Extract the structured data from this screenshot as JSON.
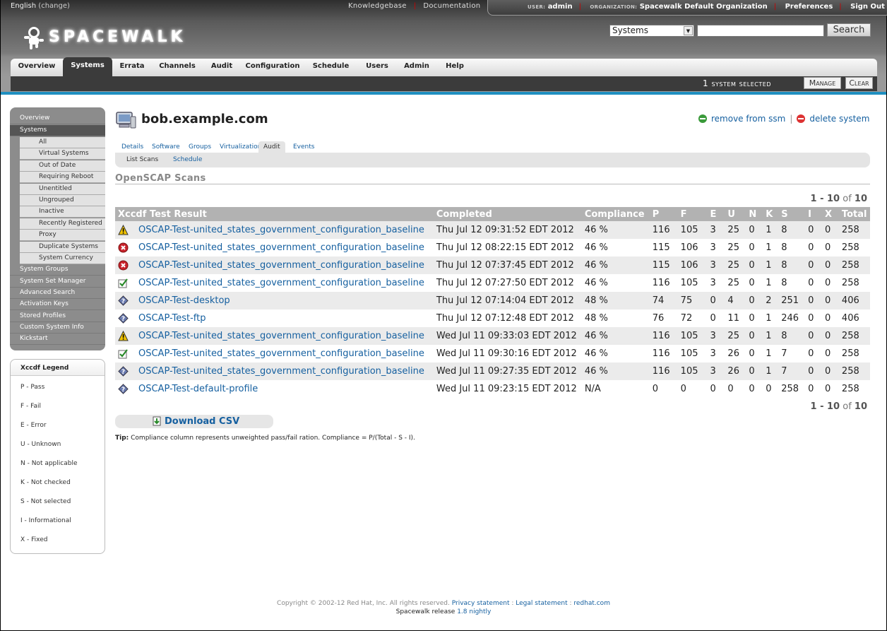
{
  "top": {
    "language": "English",
    "change": "(change)",
    "knowledgebase": "Knowledgebase",
    "documentation": "Documentation",
    "user_label": "USER:",
    "user": "admin",
    "org_label": "ORGANIZATION:",
    "org": "Spacewalk Default Organization",
    "preferences": "Preferences",
    "signout": "Sign Out"
  },
  "logo": "SPACEWALK",
  "search": {
    "scope": "Systems",
    "value": "",
    "button": "Search"
  },
  "nav": [
    "Overview",
    "Systems",
    "Errata",
    "Channels",
    "Audit",
    "Configuration",
    "Schedule",
    "Users",
    "Admin",
    "Help"
  ],
  "ssm": {
    "count": "1",
    "text": "system selected",
    "manage": "Manage",
    "clear": "Clear"
  },
  "sidebar": {
    "top": [
      "Overview",
      "Systems"
    ],
    "subs": [
      "All",
      "Virtual Systems",
      "Out of Date",
      "Requiring Reboot",
      "Unentitled",
      "Ungrouped",
      "Inactive",
      "Recently Registered",
      "Proxy",
      "Duplicate Systems",
      "System Currency"
    ],
    "bottom": [
      "System Groups",
      "System Set Manager",
      "Advanced Search",
      "Activation Keys",
      "Stored Profiles",
      "Custom System Info",
      "Kickstart"
    ]
  },
  "legend": {
    "title": "Xccdf Legend",
    "items": [
      "P - Pass",
      "F - Fail",
      "E - Error",
      "U - Unknown",
      "N - Not applicable",
      "K - Not checked",
      "S - Not selected",
      "I - Informational",
      "X - Fixed"
    ]
  },
  "system": {
    "name": "bob.example.com",
    "remove": "remove from ssm",
    "delete": "delete system"
  },
  "tabs": [
    "Details",
    "Software",
    "Groups",
    "Virtualization",
    "Audit",
    "Events"
  ],
  "subtabs": [
    "List Scans",
    "Schedule"
  ],
  "section_title": "OpenSCAP Scans",
  "pager": {
    "range": "1 - 10",
    "of": "of",
    "total": "10"
  },
  "table": {
    "headers": [
      "Xccdf Test Result",
      "Completed",
      "Compliance",
      "P",
      "F",
      "E",
      "U",
      "N",
      "K",
      "S",
      "I",
      "X",
      "Total"
    ],
    "rows": [
      {
        "icon": "warning",
        "name": "OSCAP-Test-united_states_government_configuration_baseline",
        "completed": "Thu Jul 12 09:31:52 EDT 2012",
        "compliance": "46 %",
        "p": "116",
        "f": "105",
        "e": "3",
        "u": "25",
        "n": "0",
        "k": "1",
        "s": "8",
        "i": "0",
        "x": "0",
        "total": "258"
      },
      {
        "icon": "error",
        "name": "OSCAP-Test-united_states_government_configuration_baseline",
        "completed": "Thu Jul 12 08:22:15 EDT 2012",
        "compliance": "46 %",
        "p": "115",
        "f": "106",
        "e": "3",
        "u": "25",
        "n": "0",
        "k": "1",
        "s": "8",
        "i": "0",
        "x": "0",
        "total": "258"
      },
      {
        "icon": "error",
        "name": "OSCAP-Test-united_states_government_configuration_baseline",
        "completed": "Thu Jul 12 07:37:45 EDT 2012",
        "compliance": "46 %",
        "p": "115",
        "f": "106",
        "e": "3",
        "u": "25",
        "n": "0",
        "k": "1",
        "s": "8",
        "i": "0",
        "x": "0",
        "total": "258"
      },
      {
        "icon": "ok",
        "name": "OSCAP-Test-united_states_government_configuration_baseline",
        "completed": "Thu Jul 12 07:27:50 EDT 2012",
        "compliance": "46 %",
        "p": "116",
        "f": "105",
        "e": "3",
        "u": "25",
        "n": "0",
        "k": "1",
        "s": "8",
        "i": "0",
        "x": "0",
        "total": "258"
      },
      {
        "icon": "unknown",
        "name": "OSCAP-Test-desktop",
        "completed": "Thu Jul 12 07:14:04 EDT 2012",
        "compliance": "48 %",
        "p": "74",
        "f": "75",
        "e": "0",
        "u": "4",
        "n": "0",
        "k": "2",
        "s": "251",
        "i": "0",
        "x": "0",
        "total": "406"
      },
      {
        "icon": "unknown",
        "name": "OSCAP-Test-ftp",
        "completed": "Thu Jul 12 07:12:48 EDT 2012",
        "compliance": "48 %",
        "p": "76",
        "f": "72",
        "e": "0",
        "u": "11",
        "n": "0",
        "k": "1",
        "s": "246",
        "i": "0",
        "x": "0",
        "total": "406"
      },
      {
        "icon": "warning",
        "name": "OSCAP-Test-united_states_government_configuration_baseline",
        "completed": "Wed Jul 11 09:33:03 EDT 2012",
        "compliance": "46 %",
        "p": "116",
        "f": "105",
        "e": "3",
        "u": "25",
        "n": "0",
        "k": "1",
        "s": "8",
        "i": "0",
        "x": "0",
        "total": "258"
      },
      {
        "icon": "ok",
        "name": "OSCAP-Test-united_states_government_configuration_baseline",
        "completed": "Wed Jul 11 09:30:16 EDT 2012",
        "compliance": "46 %",
        "p": "116",
        "f": "105",
        "e": "3",
        "u": "26",
        "n": "0",
        "k": "1",
        "s": "7",
        "i": "0",
        "x": "0",
        "total": "258"
      },
      {
        "icon": "unknown",
        "name": "OSCAP-Test-united_states_government_configuration_baseline",
        "completed": "Wed Jul 11 09:27:35 EDT 2012",
        "compliance": "46 %",
        "p": "116",
        "f": "105",
        "e": "3",
        "u": "26",
        "n": "0",
        "k": "1",
        "s": "7",
        "i": "0",
        "x": "0",
        "total": "258"
      },
      {
        "icon": "unknown",
        "name": "OSCAP-Test-default-profile",
        "completed": "Wed Jul 11 09:23:15 EDT 2012",
        "compliance": "N/A",
        "p": "0",
        "f": "0",
        "e": "0",
        "u": "0",
        "n": "0",
        "k": "0",
        "s": "258",
        "i": "0",
        "x": "0",
        "total": "258"
      }
    ]
  },
  "download": "Download CSV",
  "tip": {
    "label": "Tip:",
    "text": "Compliance column represents unweighted pass/fail ration. Compliance = P/(Total - S - I)."
  },
  "footer": {
    "copyright": "Copyright © 2002-12 Red Hat, Inc. All rights reserved.",
    "privacy": "Privacy statement",
    "legal": "Legal statement",
    "redhat": "redhat.com",
    "release": "Spacewalk release",
    "version": "1.8 nightly"
  },
  "colors": {
    "link": "#1660a0",
    "accent_bar": "#1f8fc0",
    "separator": "#cc0000",
    "remove_icon": "#3a9a3a",
    "delete_icon": "#d33"
  }
}
